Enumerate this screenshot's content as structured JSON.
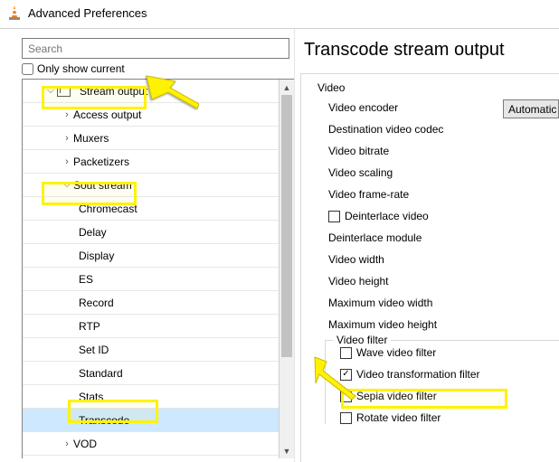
{
  "window": {
    "title": "Advanced Preferences"
  },
  "sidebar": {
    "search_placeholder": "Search",
    "only_show_current": "Only show current",
    "tree": {
      "stream_output": {
        "label": "Stream output",
        "expanded": true
      },
      "access_output": "Access output",
      "muxers": "Muxers",
      "packetizers": "Packetizers",
      "sout_stream": {
        "label": "Sout stream",
        "expanded": true
      },
      "chromecast": "Chromecast",
      "delay": "Delay",
      "display": "Display",
      "es": "ES",
      "record": "Record",
      "rtp": "RTP",
      "set_id": "Set ID",
      "standard": "Standard",
      "stats": "Stats",
      "transcode": "Transcode",
      "vod": "VOD"
    }
  },
  "content": {
    "heading": "Transcode stream output",
    "video_group": "Video",
    "video_encoder": {
      "label": "Video encoder",
      "value": "Automatic"
    },
    "dest_codec": "Destination video codec",
    "bitrate": "Video bitrate",
    "scaling": "Video scaling",
    "framerate": "Video frame-rate",
    "deinterlace_video": "Deinterlace video",
    "deinterlace_module": "Deinterlace module",
    "video_width": "Video width",
    "video_height": "Video height",
    "max_width": "Maximum video width",
    "max_height": "Maximum video height",
    "video_filter_group": "Video filter",
    "filters": {
      "wave": "Wave video filter",
      "transform": "Video transformation filter",
      "sepia": "Sepia video filter",
      "rotate": "Rotate video filter"
    }
  }
}
